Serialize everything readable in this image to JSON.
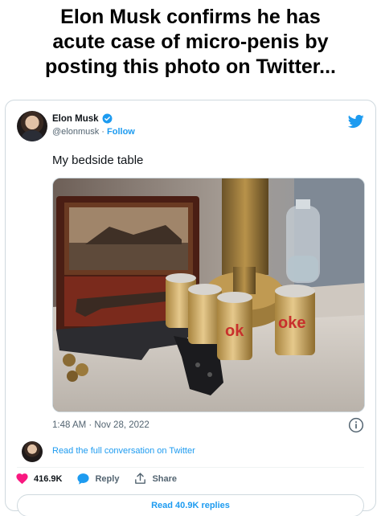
{
  "headline": {
    "line1": "Elon Musk confirms he has",
    "line2": "acute case of micro-penis by",
    "line3": "posting this photo on Twitter..."
  },
  "tweet": {
    "author_name": "Elon Musk",
    "handle": "@elonmusk",
    "separator": " · ",
    "follow_label": "Follow",
    "text": "My bedside table",
    "timestamp": "1:48 AM · Nov 28, 2022",
    "conversation_link": "Read the full conversation on Twitter",
    "like_count": "416.9K",
    "reply_label": "Reply",
    "share_label": "Share",
    "read_replies_label": "Read 40.9K replies"
  },
  "colors": {
    "accent": "#1d9bf0",
    "like": "#f91880",
    "muted_text": "#536471"
  },
  "icons": [
    "verified-badge-icon",
    "twitter-bird-icon",
    "info-icon",
    "heart-icon",
    "reply-bubble-icon",
    "share-icon"
  ]
}
